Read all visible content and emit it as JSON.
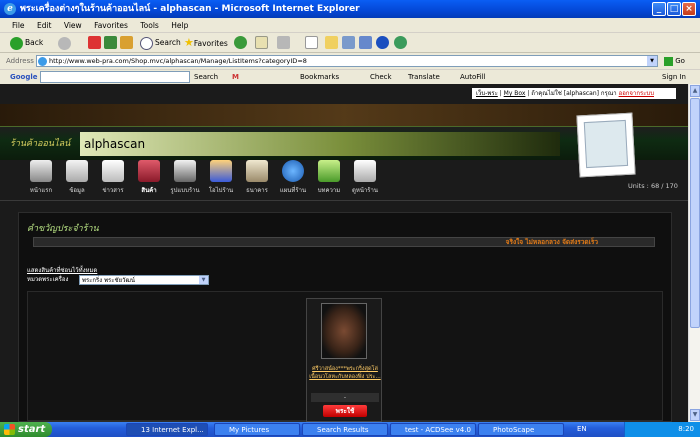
{
  "window": {
    "title": "พระเครื่องต่างๆในร้านค้าออนไลน์ - alphascan - Microsoft Internet Explorer",
    "buttons": {
      "minimize": "_",
      "maximize": "□",
      "close": "×"
    }
  },
  "menu": [
    "File",
    "Edit",
    "View",
    "Favorites",
    "Tools",
    "Help"
  ],
  "toolbar": {
    "back": "Back",
    "search": "Search",
    "favorites": "Favorites"
  },
  "address": {
    "label": "Address",
    "url": "http://www.web-pra.com/Shop.mvc/alphascan/Manage/ListItems?categoryID=8",
    "go": "Go"
  },
  "googlebar": {
    "logo": "Google",
    "search": "Search",
    "bookmarks": "Bookmarks",
    "check": "Check",
    "translate": "Translate",
    "autofill": "AutoFill",
    "signin": "Sign In"
  },
  "page": {
    "toplinks": {
      "home": "เว็บ-พระ",
      "mybox": "My Box",
      "notuser": "ถ้าคุณไม่ใช่ [alphascan] กรุณา",
      "logout": "ออกจากระบบ"
    },
    "shop_label": "ร้านค้าออนไลน์",
    "shop_name": "alphascan",
    "nav": [
      {
        "label": "หน้าแรก"
      },
      {
        "label": "ข้อมูล"
      },
      {
        "label": "ข่าวสาร"
      },
      {
        "label": "สินค้า"
      },
      {
        "label": "รูปแบบร้าน"
      },
      {
        "label": "โอไปร้าน"
      },
      {
        "label": "ธนาคาร"
      },
      {
        "label": "แผนที่ร้าน"
      },
      {
        "label": "บทความ"
      },
      {
        "label": "ดูหน้าร้าน"
      }
    ],
    "units": "Units : 68 / 170",
    "panel_title": "คำขวัญประจำร้าน",
    "slogan": "จริงใจ ไม่หลอกลวง จัดส่งรวดเร็ว",
    "show_all": "แสดงสินค้าที่ซ่อนไว้ทั้งหมด",
    "category_label": "หมวดพระเครื่อง",
    "category_value": "พระกริ่ง พระชัยวัฒน์",
    "product": {
      "title": "ศรีวาสน์อง***พระกริ่งสุดโล่ เนื้อนวโลหะกับหลองฟิ่ง ประ...",
      "price": "-",
      "buy": "พระใช้"
    }
  },
  "taskbar": {
    "start": "start",
    "tasks": [
      "13 Internet Expl...",
      "My Pictures",
      "Search Results",
      "test - ACDSee v4.0",
      "PhotoScape"
    ],
    "lang": "EN",
    "time": "8:20"
  },
  "colors": {
    "title_blue": "#0447d6",
    "slogan_orange": "#e07a18",
    "panel_green_text": "#b6e082",
    "buy_red": "#c10000",
    "link_gold": "#ffcc66"
  }
}
